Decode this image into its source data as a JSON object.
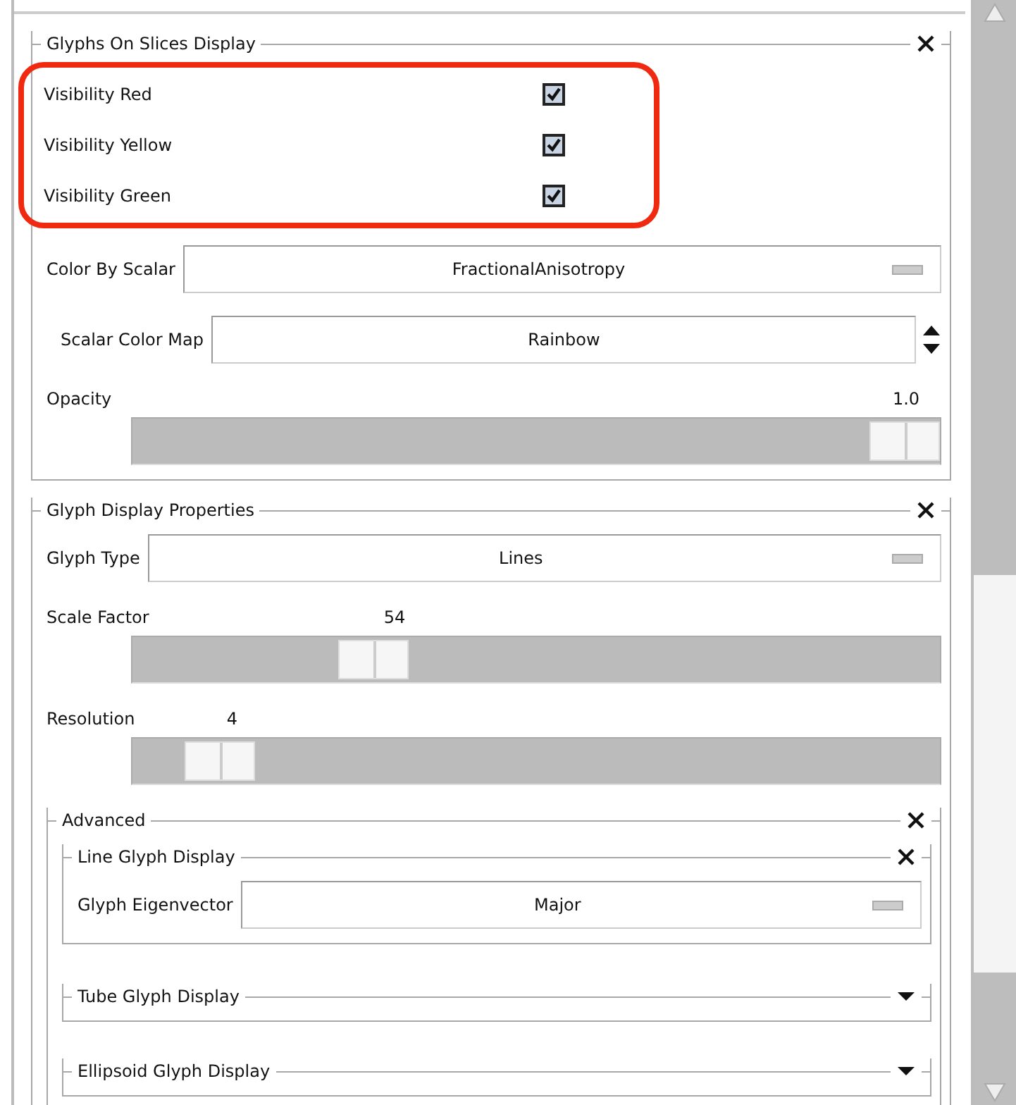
{
  "sections": [
    {
      "title": "Glyphs On Slices Display",
      "expanded": true,
      "rows": [
        {
          "kind": "checkbox",
          "label": "Visibility Red",
          "checked": true,
          "highlighted": true
        },
        {
          "kind": "checkbox",
          "label": "Visibility Yellow",
          "checked": true,
          "highlighted": true
        },
        {
          "kind": "checkbox",
          "label": "Visibility Green",
          "checked": true,
          "highlighted": true
        },
        {
          "kind": "dropdown",
          "label": "Color By Scalar",
          "value": "FractionalAnisotropy"
        },
        {
          "kind": "spinbox",
          "label": "Scalar Color Map",
          "value": "Rainbow"
        },
        {
          "kind": "slider",
          "label": "Opacity",
          "reading": "1.0",
          "level": 1.0
        }
      ]
    },
    {
      "title": "Glyph Display Properties",
      "expanded": true,
      "rows": [
        {
          "kind": "dropdown",
          "label": "Glyph Type",
          "value": "Lines"
        },
        {
          "kind": "slider",
          "label": "Scale Factor",
          "reading": "54",
          "level": 0.28
        },
        {
          "kind": "slider",
          "label": "Resolution",
          "reading": "4",
          "level": 0.07
        },
        {
          "kind": "section",
          "title": "Advanced",
          "expanded": true,
          "rows": [
            {
              "kind": "section",
              "title": "Line Glyph Display",
              "expanded": true,
              "rows": [
                {
                  "kind": "dropdown",
                  "label": "Glyph Eigenvector",
                  "value": "Major"
                }
              ]
            },
            {
              "kind": "section",
              "title": "Tube Glyph Display",
              "expanded": false,
              "rows": []
            },
            {
              "kind": "section",
              "title": "Ellipsoid Glyph Display",
              "expanded": false,
              "rows": []
            }
          ]
        }
      ]
    }
  ]
}
